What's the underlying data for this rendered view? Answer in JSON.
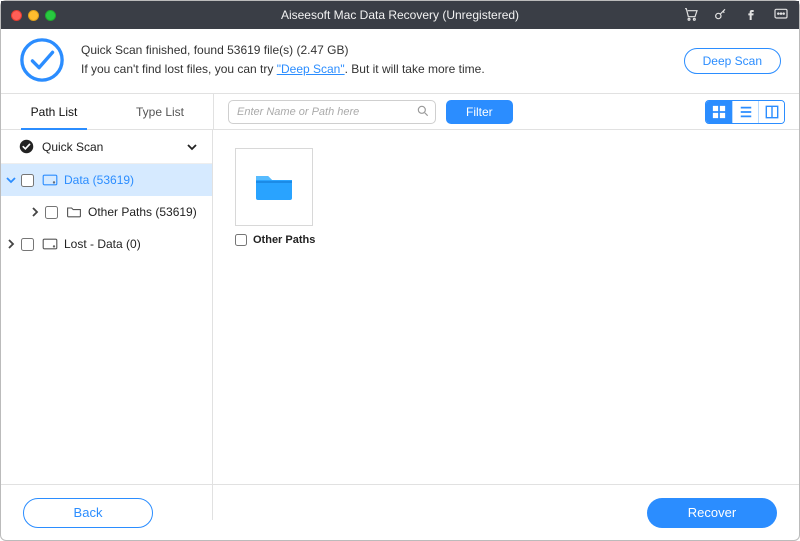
{
  "titlebar": {
    "title": "Aiseesoft Mac Data Recovery (Unregistered)"
  },
  "banner": {
    "line1_prefix": "Quick Scan finished, found ",
    "file_count": "53619",
    "line1_mid": " file(s) ",
    "total_size": "(2.47 GB)",
    "line2_prefix": "If you can't find lost files, you can try ",
    "deep_scan_link": "\"Deep Scan\"",
    "line2_suffix": ". But it will take more time.",
    "deep_scan_button": "Deep Scan"
  },
  "tabs": {
    "path_list": "Path List",
    "type_list": "Type List"
  },
  "toolbar": {
    "search_placeholder": "Enter Name or Path here",
    "filter_button": "Filter"
  },
  "sidebar": {
    "root_label": "Quick Scan",
    "items": [
      {
        "label": "Data (53619)",
        "selected": true,
        "expanded": true
      },
      {
        "label": "Other Paths (53619)",
        "selected": false,
        "expanded": false
      },
      {
        "label": "Lost - Data (0)",
        "selected": false,
        "expanded": false
      }
    ]
  },
  "files": {
    "items": [
      {
        "label": "Other Paths"
      }
    ]
  },
  "footer": {
    "back_label": "Back",
    "recover_label": "Recover"
  },
  "colors": {
    "accent": "#2b8dff",
    "titlebar_bg": "#3a3e46",
    "selected_bg": "#d6eaff"
  }
}
